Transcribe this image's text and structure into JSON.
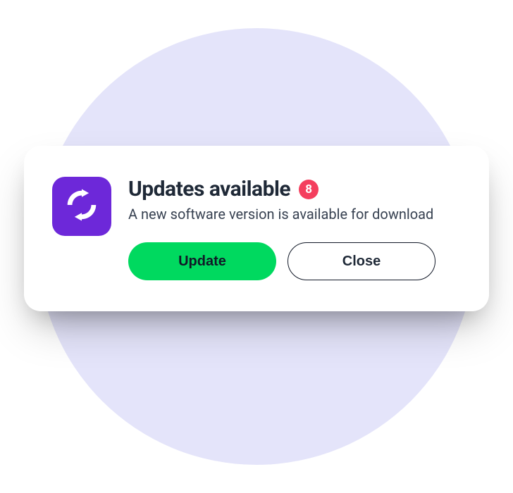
{
  "dialog": {
    "title": "Updates available",
    "badge_count": "8",
    "subtitle": "A new software version is available for download",
    "icon_name": "sync-arrows-icon",
    "accent_color": "#6d28d9",
    "badge_color": "#f43f5e",
    "buttons": {
      "primary": "Update",
      "secondary": "Close"
    }
  }
}
